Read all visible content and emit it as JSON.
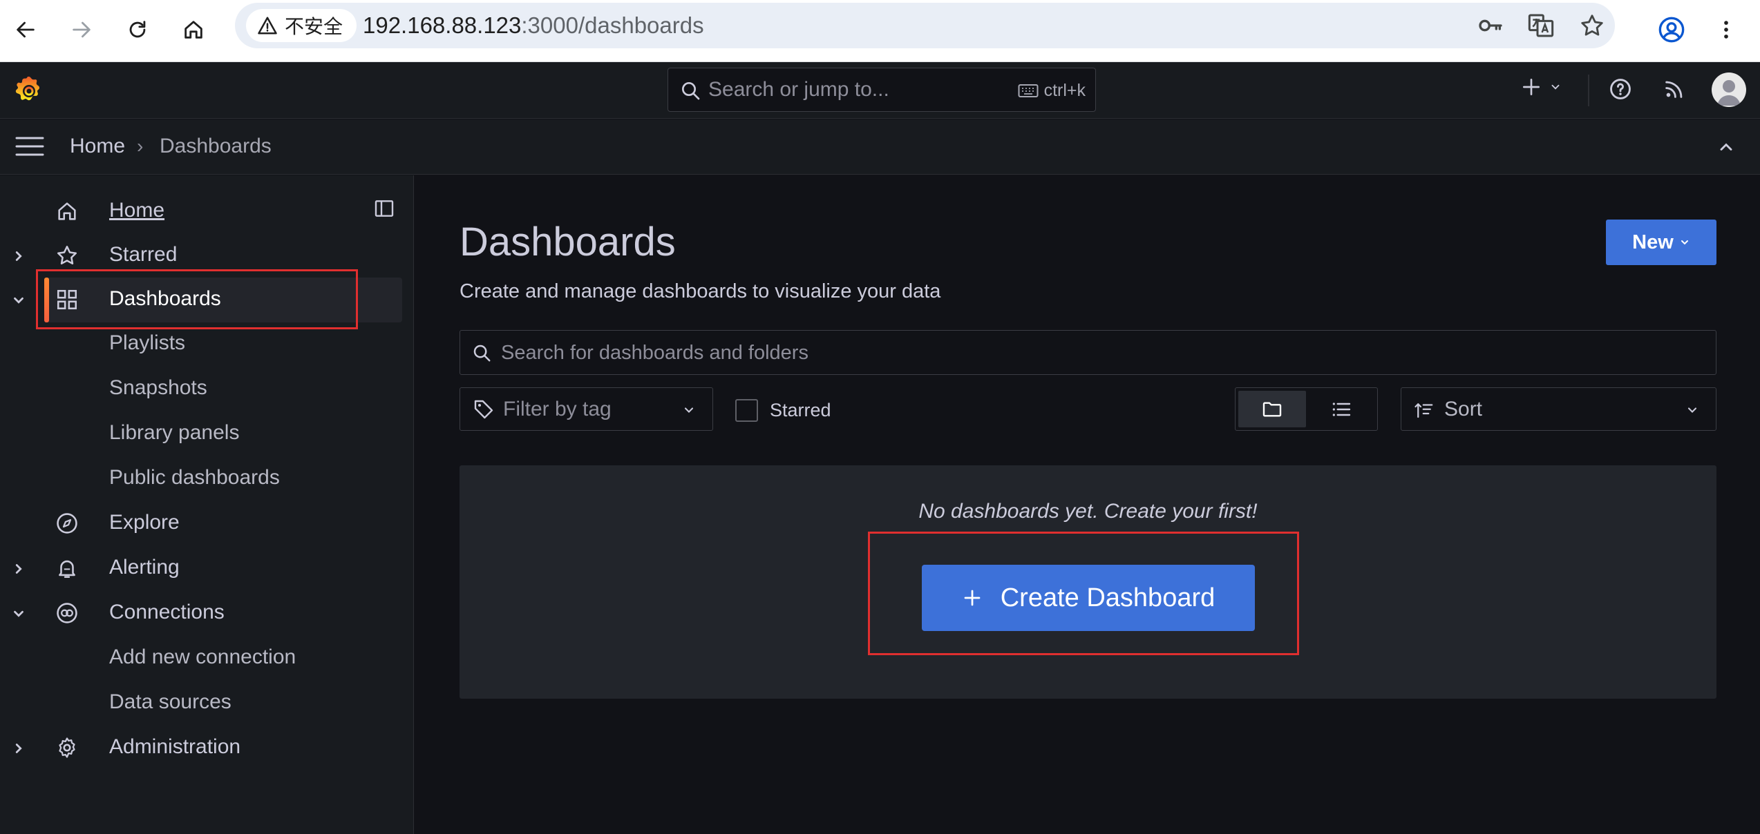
{
  "browser": {
    "security_label": "不安全",
    "url_host": "192.168.88.123",
    "url_path": ":3000/dashboards"
  },
  "topbar": {
    "search_placeholder": "Search or jump to...",
    "search_shortcut": "ctrl+k"
  },
  "breadcrumb": {
    "home": "Home",
    "separator": "›",
    "current": "Dashboards"
  },
  "sidebar": {
    "items": [
      {
        "label": "Home",
        "icon": "home-icon",
        "active": false,
        "underlined": true
      },
      {
        "label": "Starred",
        "icon": "star-icon",
        "chevron": "right"
      },
      {
        "label": "Dashboards",
        "icon": "apps-icon",
        "chevron": "down",
        "active": true
      },
      {
        "label": "Playlists",
        "sub": true
      },
      {
        "label": "Snapshots",
        "sub": true
      },
      {
        "label": "Library panels",
        "sub": true
      },
      {
        "label": "Public dashboards",
        "sub": true
      },
      {
        "label": "Explore",
        "icon": "compass-icon"
      },
      {
        "label": "Alerting",
        "icon": "bell-icon",
        "chevron": "right"
      },
      {
        "label": "Connections",
        "icon": "connections-icon",
        "chevron": "down"
      },
      {
        "label": "Add new connection",
        "sub": true
      },
      {
        "label": "Data sources",
        "sub": true
      },
      {
        "label": "Administration",
        "icon": "gear-icon",
        "chevron": "right"
      }
    ]
  },
  "main": {
    "title": "Dashboards",
    "subtitle": "Create and manage dashboards to visualize your data",
    "new_button": "New",
    "search_placeholder": "Search for dashboards and folders",
    "tag_filter_placeholder": "Filter by tag",
    "starred_label": "Starred",
    "sort_label": "Sort",
    "empty_message": "No dashboards yet. Create your first!",
    "create_button": "Create Dashboard"
  },
  "colors": {
    "accent_blue": "#3d71d9",
    "active_bar": "#f55f3e",
    "highlight_red": "#e02f2f",
    "background": "#111217",
    "panel": "#181b1f"
  }
}
